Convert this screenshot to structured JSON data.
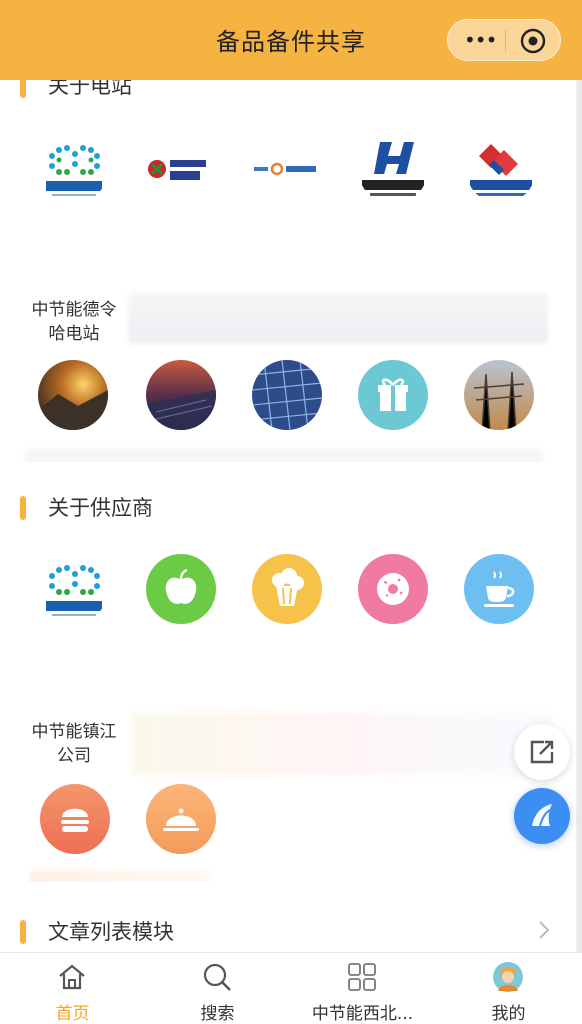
{
  "navbar": {
    "title": "备品备件共享",
    "menu_glyph": "•••"
  },
  "station_section": {
    "title": "关于电站",
    "logos": [
      {
        "name": "中国节能",
        "icon": "cecep-logo"
      },
      {
        "name": "国家电投 SPIC",
        "icon": "spic-logo"
      },
      {
        "name": "中广核 CGN",
        "icon": "cgn-logo"
      },
      {
        "name": "中国华能",
        "icon": "huaneng-logo"
      },
      {
        "name": "中国电建",
        "icon": "powerchina-logo"
      }
    ],
    "first_caption": "中节能德令哈电站",
    "photos": [
      "sunset-photo",
      "solar-sunset-photo",
      "solar-panels-photo",
      "gift-icon",
      "substation-photo"
    ]
  },
  "supplier_section": {
    "title": "关于供应商",
    "first_caption": "中节能镇江公司",
    "icons": [
      "cecep-logo",
      "apple-icon",
      "popcorn-icon",
      "donut-icon",
      "coffee-icon",
      "burger-icon",
      "cloche-icon"
    ]
  },
  "article_section": {
    "title": "文章列表模块"
  },
  "tabbar": {
    "tabs": [
      {
        "label": "首页",
        "icon": "home-icon",
        "active": true
      },
      {
        "label": "搜索",
        "icon": "search-icon",
        "active": false
      },
      {
        "label": "中节能西北...",
        "icon": "grid-icon",
        "active": false
      },
      {
        "label": "我的",
        "icon": "avatar-icon",
        "active": false
      }
    ]
  },
  "colors": {
    "accent": "#F5B342",
    "active_tab": "#F5A623",
    "service": "#3d8ef2"
  }
}
